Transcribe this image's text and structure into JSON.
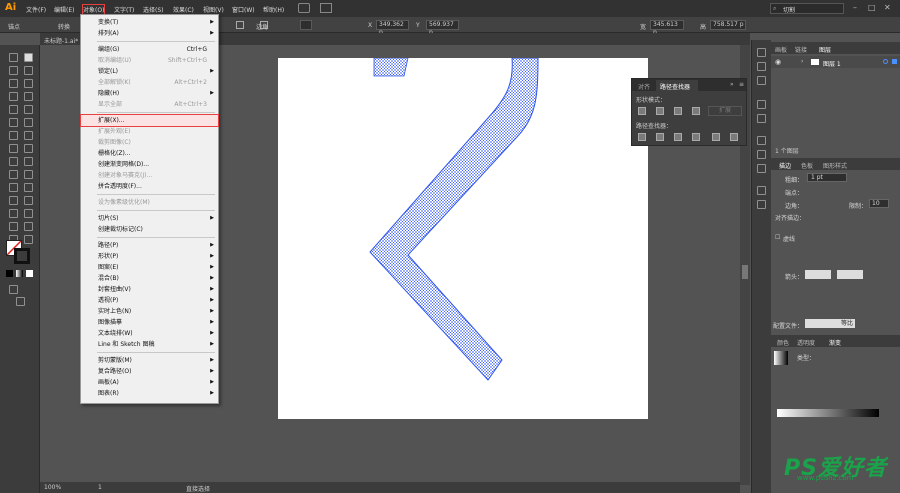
{
  "app": {
    "logo": "Ai",
    "search_text": "切割"
  },
  "menubar": {
    "items": [
      "文件(F)",
      "编辑(E)",
      "对象(O)",
      "文字(T)",
      "选择(S)",
      "效果(C)",
      "视图(V)",
      "窗口(W)",
      "帮助(H)"
    ]
  },
  "control_bar": {
    "label": "锚点",
    "convert_label": "转换",
    "corner_label": "边角",
    "x_label": "X",
    "x_value": "349.362 p",
    "y_label": "Y",
    "y_value": "569.937 p",
    "w_label": "宽",
    "w_value": "345.613 p",
    "h_label": "高",
    "h_value": "758.517 p"
  },
  "document": {
    "tab_title": "未标题-1.ai*"
  },
  "status": {
    "zoom": "100%",
    "artboard": "1",
    "tool_name": "直接选择"
  },
  "object_menu": {
    "items": [
      {
        "label": "变换(T)",
        "submenu": true
      },
      {
        "label": "排列(A)",
        "submenu": true
      },
      {
        "sep": true
      },
      {
        "label": "编组(G)",
        "shortcut": "Ctrl+G"
      },
      {
        "label": "取消编组(U)",
        "shortcut": "Shift+Ctrl+G",
        "disabled": true
      },
      {
        "label": "锁定(L)",
        "submenu": true
      },
      {
        "label": "全部解锁(K)",
        "shortcut": "Alt+Ctrl+2",
        "disabled": true
      },
      {
        "label": "隐藏(H)",
        "submenu": true
      },
      {
        "label": "显示全部",
        "shortcut": "Alt+Ctrl+3",
        "disabled": true
      },
      {
        "sep": true
      },
      {
        "label": "扩展(X)...",
        "highlight": true
      },
      {
        "label": "扩展外观(E)",
        "disabled": true
      },
      {
        "label": "裁剪图像(C)",
        "disabled": true
      },
      {
        "label": "栅格化(Z)..."
      },
      {
        "label": "创建渐变网格(D)..."
      },
      {
        "label": "创建对象马赛克(J)...",
        "disabled": true
      },
      {
        "label": "拼合透明度(F)..."
      },
      {
        "sep": true
      },
      {
        "label": "设为像素级优化(M)",
        "disabled": true
      },
      {
        "sep": true
      },
      {
        "label": "切片(S)",
        "submenu": true
      },
      {
        "label": "创建裁切标记(C)"
      },
      {
        "sep": true
      },
      {
        "label": "路径(P)",
        "submenu": true
      },
      {
        "label": "形状(P)",
        "submenu": true
      },
      {
        "label": "图案(E)",
        "submenu": true
      },
      {
        "label": "混合(B)",
        "submenu": true
      },
      {
        "label": "封套扭曲(V)",
        "submenu": true
      },
      {
        "label": "透视(P)",
        "submenu": true
      },
      {
        "label": "实时上色(N)",
        "submenu": true
      },
      {
        "label": "图像描摹",
        "submenu": true
      },
      {
        "label": "文本绕排(W)",
        "submenu": true
      },
      {
        "label": "Line 和 Sketch 图稿",
        "submenu": true
      },
      {
        "sep": true
      },
      {
        "label": "剪切蒙版(M)",
        "submenu": true
      },
      {
        "label": "复合路径(O)",
        "submenu": true
      },
      {
        "label": "画板(A)",
        "submenu": true
      },
      {
        "label": "图表(R)",
        "submenu": true
      }
    ]
  },
  "pathfinder": {
    "tabs": [
      "对齐",
      "路径查找器"
    ],
    "shape_modes_label": "形状模式：",
    "expand_button": "扩展",
    "pathfinders_label": "路径查找器："
  },
  "layers_panel": {
    "tabs": [
      "画板",
      "链接",
      "图层"
    ],
    "layer_name": "图层 1",
    "footer": "1 个图层"
  },
  "stroke_panel": {
    "tabs": [
      "描边",
      "色板",
      "图形样式"
    ],
    "weight_label": "粗细：",
    "weight_value": "1 pt",
    "cap_label": "端点：",
    "corner_label": "边角：",
    "limit_label": "限制：",
    "limit_value": "10",
    "align_label": "对齐描边：",
    "dashed_label": "虚线",
    "arrow_label": "箭头：",
    "profile_label": "配置文件：",
    "profile_value": "等比"
  },
  "gradient_panel": {
    "tabs": [
      "颜色",
      "透明度",
      "渐变"
    ],
    "type_label": "类型："
  },
  "watermark": {
    "text": "PS爱好者",
    "url": "www.psahz.com"
  }
}
